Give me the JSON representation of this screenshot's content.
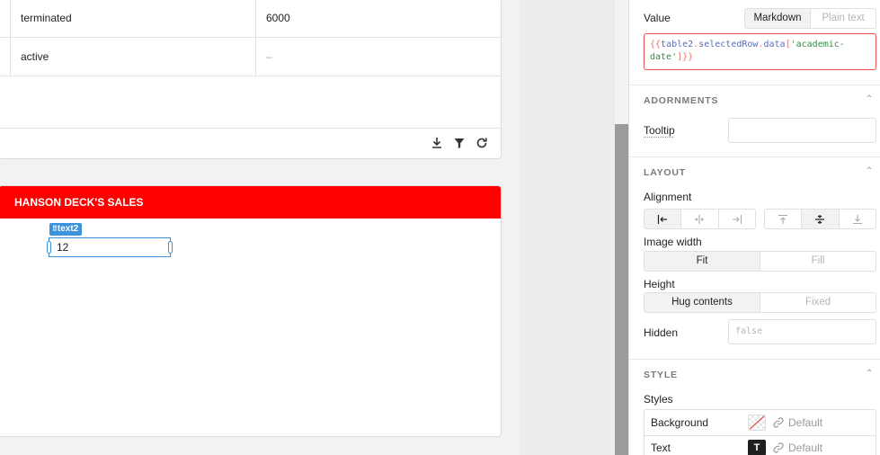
{
  "table": {
    "rows": [
      {
        "status": "terminated",
        "amount": "6000"
      },
      {
        "status": "active",
        "amount": "–"
      }
    ],
    "footer_icons": [
      "download-icon",
      "filter-icon",
      "refresh-icon"
    ]
  },
  "container": {
    "title": "HANSON DECK'S SALES",
    "title_color": "#ff0000",
    "text_component": {
      "name": "text2",
      "value": "12"
    }
  },
  "inspector": {
    "value": {
      "label": "Value",
      "mode_options": [
        "Markdown",
        "Plain text"
      ],
      "selected_mode": "Markdown",
      "code": {
        "open": "{{",
        "object": "table2",
        "dot1": ".",
        "property": "selectedRow",
        "dot2": ".",
        "data": "data",
        "bracket_open": "[",
        "key": "'academic-date'",
        "bracket_close": "]",
        "close": "}}"
      }
    },
    "adornments": {
      "title": "ADORNMENTS",
      "tooltip_label": "Tooltip",
      "tooltip_value": ""
    },
    "layout": {
      "title": "LAYOUT",
      "alignment_label": "Alignment",
      "horizontal_align_icons": [
        "align-left-icon",
        "align-center-icon",
        "align-right-icon"
      ],
      "selected_horizontal": "align-left-icon",
      "vertical_align_icons": [
        "align-top-icon",
        "align-middle-icon",
        "align-bottom-icon"
      ],
      "selected_vertical": "align-middle-icon",
      "image_width_label": "Image width",
      "image_width_options": [
        "Fit",
        "Fill"
      ],
      "image_width_selected": "Fit",
      "height_label": "Height",
      "height_options": [
        "Hug contents",
        "Fixed"
      ],
      "height_selected": "Hug contents",
      "hidden_label": "Hidden",
      "hidden_placeholder": "false"
    },
    "style": {
      "title": "STYLE",
      "styles_label": "Styles",
      "rows": [
        {
          "name": "Background",
          "value": "Default",
          "swatch": "transparent-swatch"
        },
        {
          "name": "Text",
          "value": "Default",
          "swatch": "text-swatch",
          "swatch_glyph": "T"
        }
      ]
    }
  }
}
